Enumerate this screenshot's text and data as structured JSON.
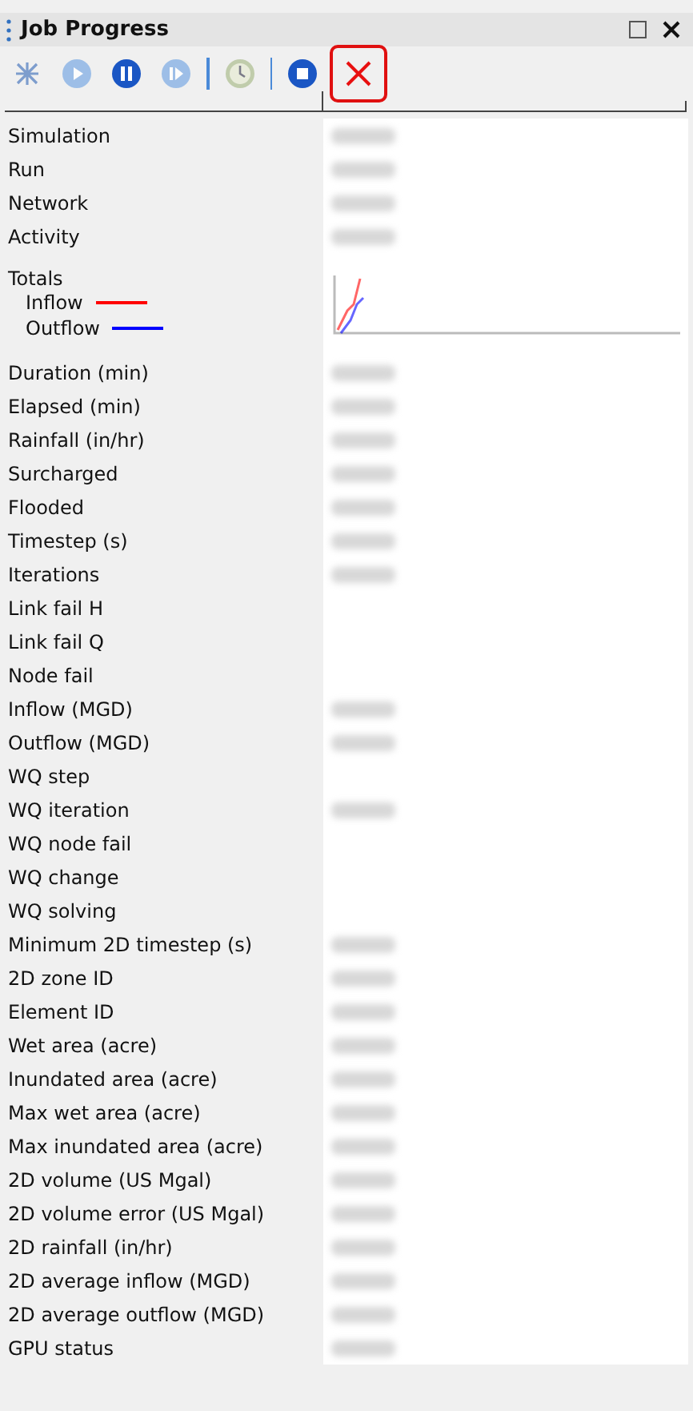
{
  "window": {
    "title": "Job Progress"
  },
  "toolbar": [
    {
      "kind": "scatter",
      "disabled": true
    },
    {
      "kind": "play",
      "disabled": true
    },
    {
      "kind": "pause",
      "disabled": false
    },
    {
      "kind": "step",
      "disabled": true
    },
    {
      "kind": "separator"
    },
    {
      "kind": "clock",
      "disabled": true
    },
    {
      "kind": "separator"
    },
    {
      "kind": "stop",
      "disabled": false
    },
    {
      "kind": "cancel",
      "disabled": false,
      "highlighted": true
    }
  ],
  "rows": [
    {
      "label": "Simulation",
      "blurred": true
    },
    {
      "label": "Run",
      "blurred": true
    },
    {
      "label": "Network",
      "blurred": true
    },
    {
      "label": "Activity",
      "blurred": true
    },
    {
      "label": "Totals",
      "kind": "totals",
      "legend": [
        {
          "label": "Inflow",
          "color": "#ff0000"
        },
        {
          "label": "Outflow",
          "color": "#0000ff"
        }
      ]
    },
    {
      "label": "Duration (min)",
      "blurred": true
    },
    {
      "label": "Elapsed (min)",
      "blurred": true
    },
    {
      "label": "Rainfall (in/hr)",
      "blurred": true
    },
    {
      "label": "Surcharged",
      "blurred": true
    },
    {
      "label": "Flooded",
      "blurred": true
    },
    {
      "label": "Timestep (s)",
      "blurred": true
    },
    {
      "label": "Iterations",
      "blurred": true
    },
    {
      "label": "Link fail H",
      "blurred": false
    },
    {
      "label": "Link fail Q",
      "blurred": false
    },
    {
      "label": "Node fail",
      "blurred": false
    },
    {
      "label": "Inflow (MGD)",
      "blurred": true
    },
    {
      "label": "Outflow (MGD)",
      "blurred": true
    },
    {
      "label": "WQ step",
      "blurred": false
    },
    {
      "label": "WQ iteration",
      "blurred": true
    },
    {
      "label": "WQ node fail",
      "blurred": false
    },
    {
      "label": "WQ change",
      "blurred": false
    },
    {
      "label": "WQ solving",
      "blurred": false
    },
    {
      "label": "Minimum 2D timestep (s)",
      "blurred": true
    },
    {
      "label": "2D zone ID",
      "blurred": true
    },
    {
      "label": "Element ID",
      "blurred": true
    },
    {
      "label": "Wet area (acre)",
      "blurred": true
    },
    {
      "label": "Inundated area (acre)",
      "blurred": true
    },
    {
      "label": "Max wet area (acre)",
      "blurred": true
    },
    {
      "label": "Max inundated area (acre)",
      "blurred": true
    },
    {
      "label": "2D volume (US Mgal)",
      "blurred": true
    },
    {
      "label": "2D volume error (US Mgal)",
      "blurred": true
    },
    {
      "label": "2D rainfall (in/hr)",
      "blurred": true
    },
    {
      "label": "2D average inflow (MGD)",
      "blurred": true
    },
    {
      "label": "2D average outflow (MGD)",
      "blurred": true
    },
    {
      "label": "GPU status",
      "blurred": true
    }
  ]
}
